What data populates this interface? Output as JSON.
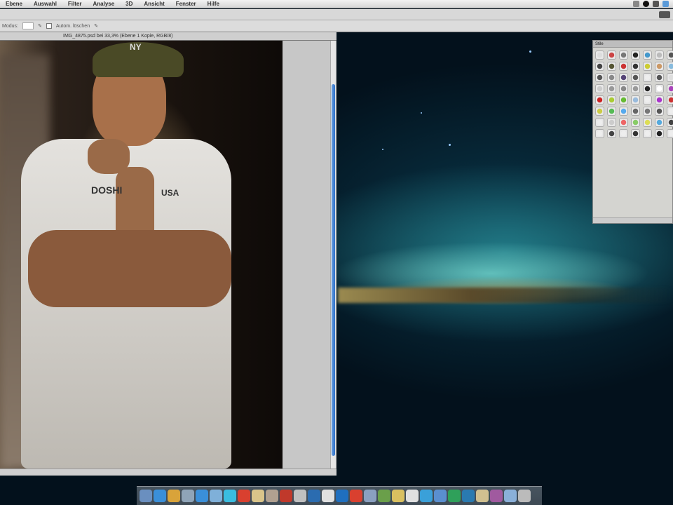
{
  "menubar": {
    "items": [
      "Ebene",
      "Auswahl",
      "Filter",
      "Analyse",
      "3D",
      "Ansicht",
      "Fenster",
      "Hilfe"
    ]
  },
  "document": {
    "tab_title": "IMG_4875.psd bei 33,3% (Ebene 1 Kopie, RGB/8)"
  },
  "options": {
    "label": "Modus:",
    "checkbox_label": "Autom. löschen"
  },
  "photo": {
    "shirt_text_left": "DOSHI",
    "shirt_text_right": "USA",
    "cap_logo": "NY"
  },
  "styles_panel": {
    "tab": "Stile",
    "swatch_colors": [
      "#ddd",
      "#c44",
      "#777",
      "#222",
      "#49c",
      "#bbb",
      "#555",
      "#444",
      "#553",
      "#c33",
      "#333",
      "#cc3",
      "#c96",
      "#8bd",
      "#555",
      "#888",
      "#547",
      "#555",
      "#eee",
      "#555",
      "#ddd",
      "#ccc",
      "#999",
      "#888",
      "#999",
      "#222",
      "#fff",
      "#a4b",
      "#c22",
      "#ac3",
      "#6b3",
      "#9bd",
      "#eee",
      "#a3c",
      "#c33",
      "#cc4",
      "#5b5",
      "#5ae",
      "#666",
      "#777",
      "#555",
      "#eee",
      "#eee",
      "#ccc",
      "#e66",
      "#8c6",
      "#dd5",
      "#5ad",
      "#444",
      "#eee",
      "#444",
      "#eee",
      "#333",
      "#eee",
      "#222",
      "#eee"
    ]
  },
  "dock": {
    "apps": [
      "finder",
      "safari",
      "ichat",
      "mail",
      "itunes",
      "preview",
      "twitter",
      "flash",
      "notes",
      "photoshop",
      "acrobat",
      "textedit",
      "word",
      "calendar",
      "outlook",
      "powerpoint",
      "iphoto",
      "garageband",
      "stickies",
      "pages",
      "app-store",
      "keynote",
      "skype",
      "tweetie",
      "itunes-music",
      "filezilla",
      "folder",
      "trash"
    ],
    "colors": [
      "#6a8fbf",
      "#3a8fd9",
      "#d9a33a",
      "#8fa4b8",
      "#3a8fd9",
      "#7fb0d9",
      "#3abde0",
      "#d9402f",
      "#d9c48a",
      "#b0a090",
      "#c0392b",
      "#c0c0c0",
      "#2b6cb0",
      "#e0e0e0",
      "#1f6fbf",
      "#d9402f",
      "#8aa0c0",
      "#6a9f4a",
      "#d9c060",
      "#e0e0e0",
      "#3aa0d9",
      "#5a8fd0",
      "#2fa05a",
      "#2a7ab0",
      "#d0c090",
      "#a05a9f",
      "#8ab0d9",
      "#bbb"
    ]
  }
}
